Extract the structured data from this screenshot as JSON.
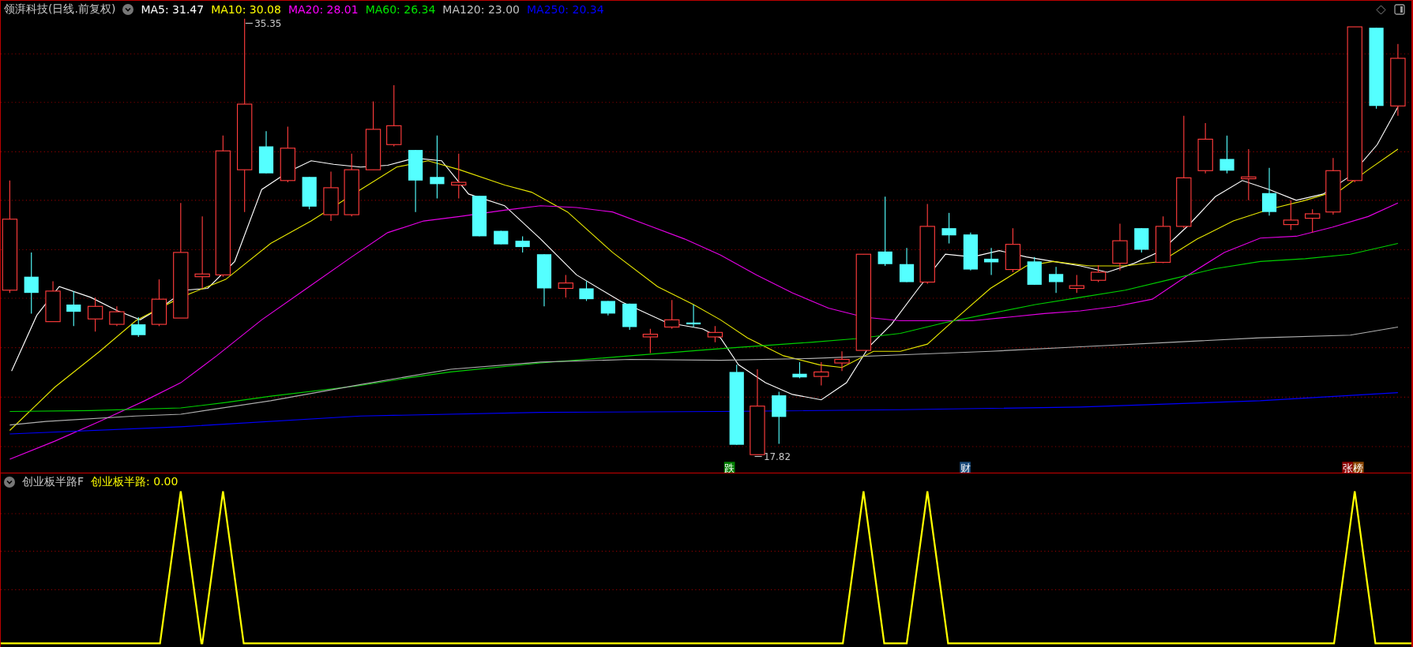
{
  "chart_header": {
    "title": "领湃科技(日线.前复权)",
    "indicators": [
      {
        "label": "MA5: 31.47",
        "color": "#ffffff"
      },
      {
        "label": "MA10: 30.08",
        "color": "#ffff00"
      },
      {
        "label": "MA20: 28.01",
        "color": "#ff00ff"
      },
      {
        "label": "MA60: 26.34",
        "color": "#00e600"
      },
      {
        "label": "MA120: 23.00",
        "color": "#c0c0c0"
      },
      {
        "label": "MA250: 20.34",
        "color": "#0000ff"
      }
    ]
  },
  "price_labels": [
    {
      "text": "35.35"
    },
    {
      "text": "17.82"
    }
  ],
  "event_markers": [
    {
      "chars": [
        {
          "text": "跌",
          "color": "#008000"
        }
      ]
    },
    {
      "chars": [
        {
          "text": "财",
          "color": "#1a4a7a"
        }
      ]
    },
    {
      "chars": [
        {
          "text": "张",
          "color": "#8b0000"
        },
        {
          "text": "榜",
          "color": "#8b4500"
        }
      ]
    }
  ],
  "indicator_panel": {
    "name": "创业板半路F",
    "value_label": "创业板半路: 0.00"
  }
}
